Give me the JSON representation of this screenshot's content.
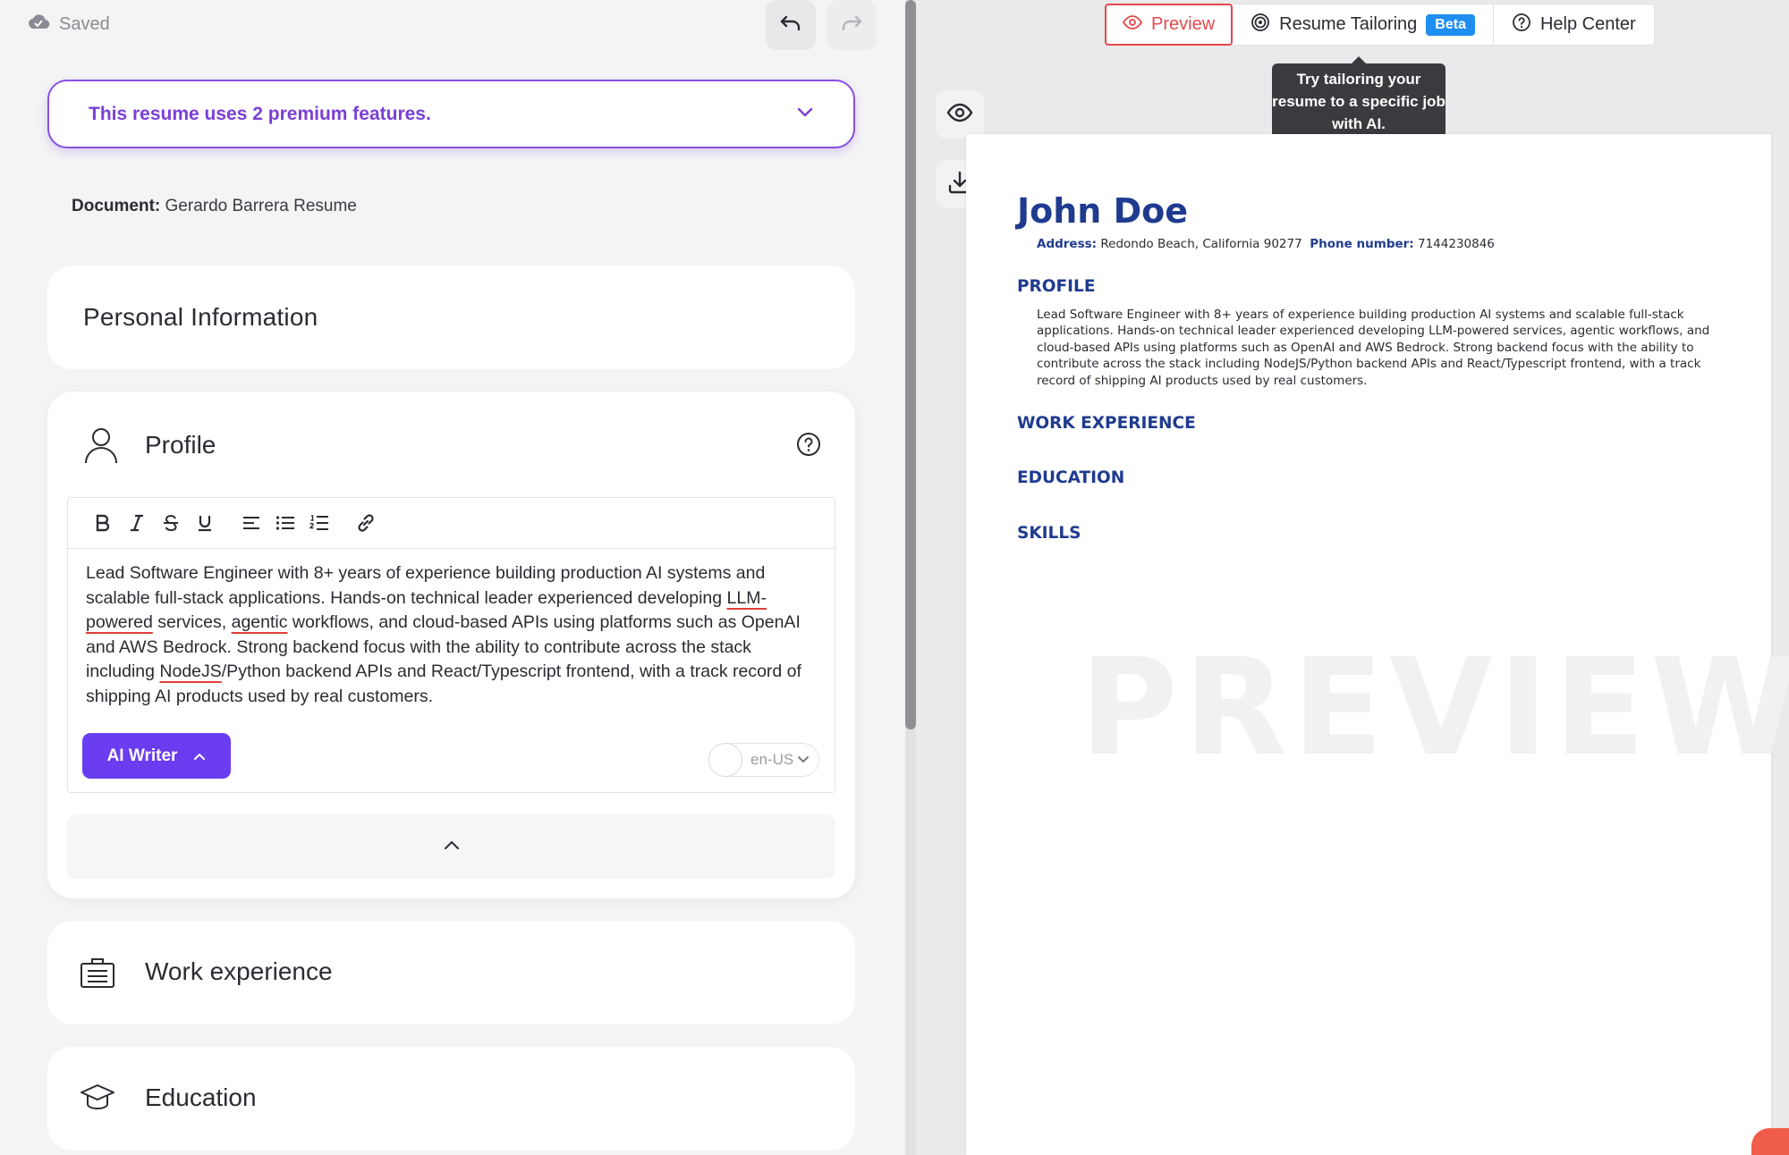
{
  "editor": {
    "saved_label": "Saved",
    "premium_banner": "This resume uses 2 premium features.",
    "document_label": "Document:",
    "document_name": "Gerardo Barrera Resume",
    "sections": {
      "personal": "Personal Information",
      "profile": "Profile",
      "work": "Work experience",
      "education": "Education"
    },
    "profile_text": {
      "p1": "Lead Software Engineer with 8+ years of experience building production AI systems and scalable full-stack applications. Hands-on technical leader experienced developing ",
      "w1": "LLM-powered",
      "p2": " services, ",
      "w2": "agentic",
      "p3": " workflows, and cloud-based APIs using platforms such as OpenAI and AWS Bedrock. Strong backend focus with the ability to contribute across the stack including ",
      "w3": "NodeJS",
      "p4": "/Python backend APIs and React/Typescript frontend, with a track record of shipping AI products used by real customers."
    },
    "ai_writer_label": "AI Writer",
    "language": "en-US",
    "toolbar_icons": [
      "bold-icon",
      "italic-icon",
      "strikethrough-icon",
      "underline-icon",
      "align-left-icon",
      "bullet-list-icon",
      "numbered-list-icon",
      "link-icon"
    ]
  },
  "preview": {
    "tabs": {
      "preview": "Preview",
      "tailoring": "Resume Tailoring",
      "beta": "Beta",
      "help": "Help Center"
    },
    "tooltip": "Try tailoring your resume to a specific job with AI.",
    "watermark": "PREVIEW",
    "resume": {
      "name": "John Doe",
      "address_label": "Address:",
      "address": "Redondo Beach, California 90277",
      "phone_label": "Phone number:",
      "phone": "7144230846",
      "profile_heading": "PROFILE",
      "profile_text": "Lead Software Engineer with 8+ years of experience building production AI systems and scalable full-stack applications. Hands-on technical leader experienced developing LLM-powered services, agentic workflows, and cloud-based APIs using platforms such as OpenAI and AWS Bedrock. Strong backend focus with the ability to contribute across the stack including NodeJS/Python backend APIs and React/Typescript frontend, with a track record of shipping AI products used by real customers.",
      "work_heading": "WORK EXPERIENCE",
      "education_heading": "EDUCATION",
      "skills_heading": "SKILLS"
    }
  },
  "colors": {
    "accent_purple": "#6a3df0",
    "premium_purple": "#7a3fd6",
    "resume_blue": "#1f3b8f",
    "preview_red": "#e5484d",
    "beta_blue": "#1f8ef1"
  }
}
